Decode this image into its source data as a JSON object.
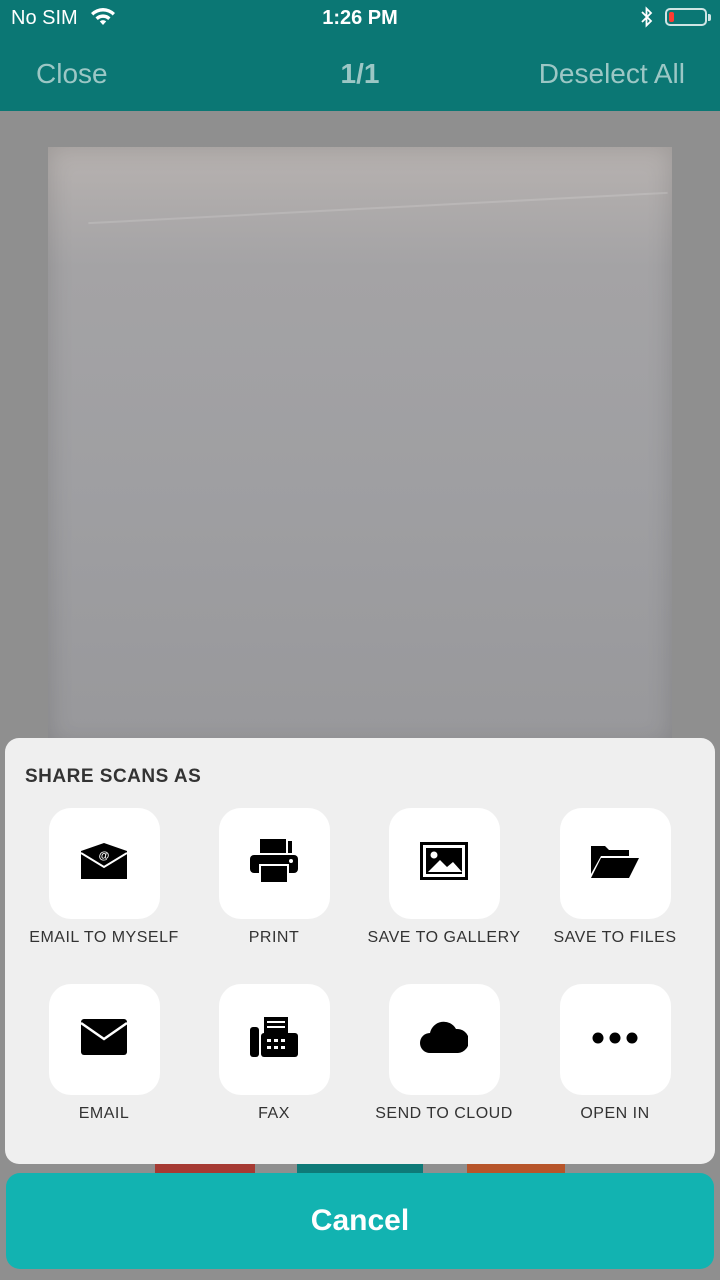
{
  "status_bar": {
    "carrier": "No SIM",
    "time": "1:26 PM",
    "wifi_icon": "wifi-icon",
    "bluetooth_icon": "bluetooth-icon",
    "battery_icon": "battery-low-icon",
    "battery_level_percent": 10
  },
  "nav": {
    "close_label": "Close",
    "page_count": "1/1",
    "deselect_label": "Deselect All"
  },
  "share_sheet": {
    "title": "SHARE SCANS AS",
    "options": [
      {
        "label": "EMAIL TO MYSELF",
        "icon": "email-to-myself-icon"
      },
      {
        "label": "PRINT",
        "icon": "printer-icon"
      },
      {
        "label": "SAVE TO GALLERY",
        "icon": "gallery-icon"
      },
      {
        "label": "SAVE TO FILES",
        "icon": "folder-open-icon"
      },
      {
        "label": "EMAIL",
        "icon": "envelope-icon"
      },
      {
        "label": "FAX",
        "icon": "fax-icon"
      },
      {
        "label": "SEND TO CLOUD",
        "icon": "cloud-icon"
      },
      {
        "label": "OPEN IN",
        "icon": "more-dots-icon"
      }
    ]
  },
  "cancel_label": "Cancel",
  "colors": {
    "nav_bg": "#0b7774",
    "accent": "#12b3b1",
    "sheet_bg": "#efefef"
  }
}
